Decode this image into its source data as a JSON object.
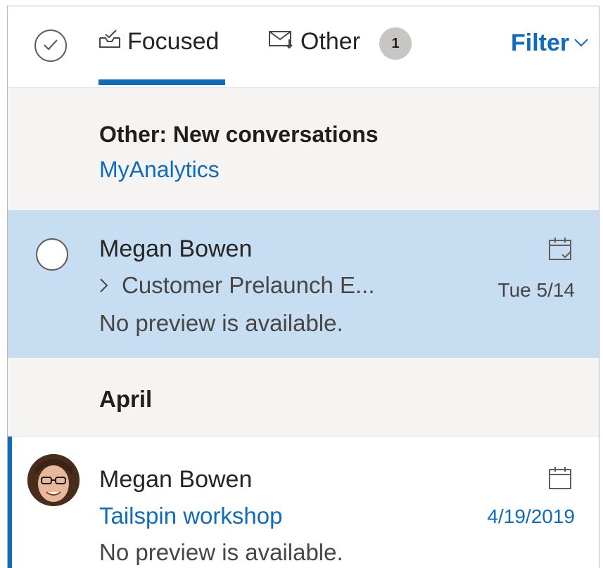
{
  "header": {
    "tabs": [
      {
        "label": "Focused",
        "icon": "inbox-icon",
        "active": true
      },
      {
        "label": "Other",
        "icon": "mail-arrow-icon",
        "badge": "1"
      }
    ],
    "filter_label": "Filter"
  },
  "notice": {
    "title": "Other: New conversations",
    "link": "MyAnalytics"
  },
  "messages": [
    {
      "sender": "Megan Bowen",
      "subject": "Customer Prelaunch E...",
      "preview": "No preview is available.",
      "date": "Tue 5/14",
      "icon": "calendar-check-icon"
    },
    {
      "sender": "Megan Bowen",
      "subject": "Tailspin workshop",
      "preview": "No preview is available.",
      "date": "4/19/2019",
      "icon": "calendar-icon"
    }
  ],
  "groups": {
    "month": "April"
  },
  "colors": {
    "accent": "#0f6cbd",
    "selected_bg": "#c7ddf2",
    "panel_bg": "#f6f4f2"
  }
}
